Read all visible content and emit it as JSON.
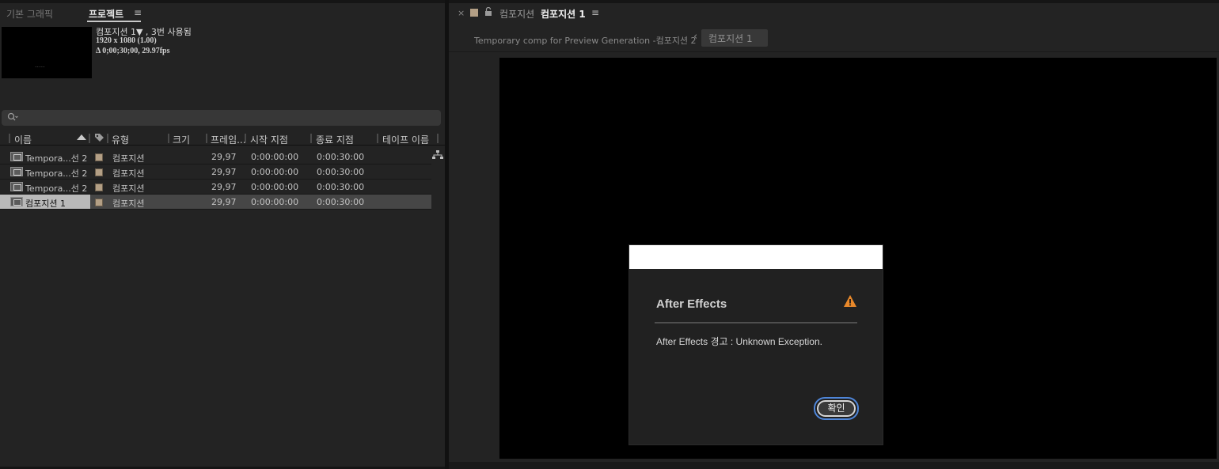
{
  "left_panel": {
    "tabs": {
      "essential_graphics": "기본 그래픽",
      "project": "프로젝트",
      "menu": "≡"
    },
    "selected_item": {
      "name": "컴포지션 1▼ , 3번 사용됨",
      "resolution": "1920 x 1080 (1.00)",
      "duration": "Δ 0;00;30;00, 29.97fps",
      "thumb_dots": "....."
    },
    "search": {
      "icon": "search-icon",
      "placeholder": "",
      "value": ""
    },
    "columns": {
      "name": "이름",
      "type": "유형",
      "size": "크기",
      "frame_rate": "프레임...",
      "start": "시작 지점",
      "end": "종료 지점",
      "tape_name": "테이프 이름"
    },
    "rows": [
      {
        "name": "Tempora...선 2",
        "type": "컴포지션",
        "frame_rate": "29,97",
        "start": "0:00:00:00",
        "end": "0:00:30:00",
        "selected": false
      },
      {
        "name": "Tempora...선 2",
        "type": "컴포지션",
        "frame_rate": "29,97",
        "start": "0:00:00:00",
        "end": "0:00:30:00",
        "selected": false
      },
      {
        "name": "Tempora...선 2",
        "type": "컴포지션",
        "frame_rate": "29,97",
        "start": "0:00:00:00",
        "end": "0:00:30:00",
        "selected": false
      },
      {
        "name": "컴포지션 1",
        "type": "컴포지션",
        "frame_rate": "29,97",
        "start": "0:00:00:00",
        "end": "0:00:30:00",
        "selected": true
      }
    ],
    "label_color": "#b39f85"
  },
  "right_panel": {
    "tab": {
      "close": "×",
      "prefix": "컴포지션",
      "name": "컴포지션 1",
      "menu": "≡"
    },
    "breadcrumb": {
      "previous": "Temporary comp for Preview Generation -컴포지션 2",
      "chevron": "‹",
      "current": "컴포지션 1"
    }
  },
  "dialog": {
    "title": "After Effects",
    "message": "After  Effects 경고 : Unknown Exception.",
    "ok_label": "확인",
    "warn_color": "#e8882a",
    "focus_color": "#4f86d9"
  }
}
